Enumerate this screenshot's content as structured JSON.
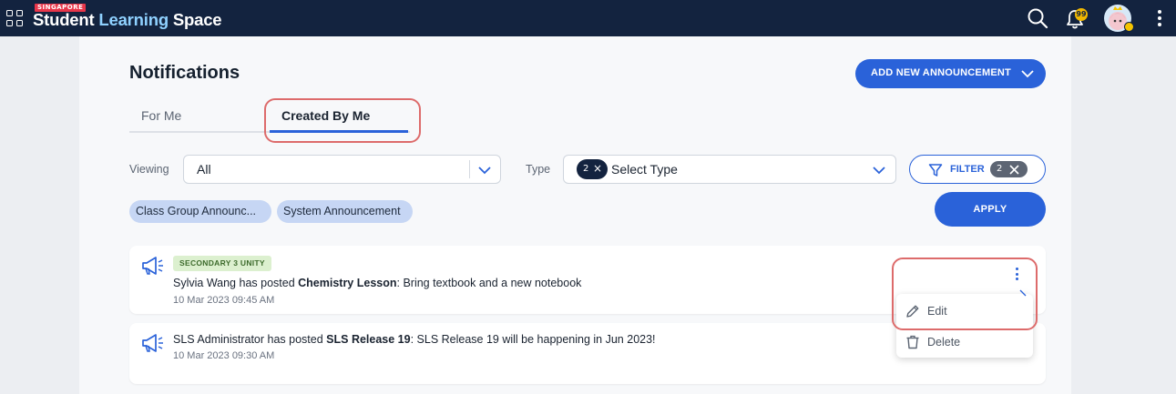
{
  "app": {
    "logo_badge": "SINGAPORE",
    "logo_part1": "Student ",
    "logo_part2": "Learning",
    "logo_part3": " Space",
    "notification_count": "99"
  },
  "page": {
    "title": "Notifications",
    "add_button_label": "ADD NEW ANNOUNCEMENT"
  },
  "tabs": [
    {
      "label": "For Me",
      "active": false
    },
    {
      "label": "Created By Me",
      "active": true
    }
  ],
  "filters": {
    "viewing_label": "Viewing",
    "viewing_value": "All",
    "type_label": "Type",
    "type_selected_count": "2",
    "type_placeholder": "Select Type",
    "filter_button_label": "FILTER",
    "filter_count": "2",
    "tags": [
      "Class Group Announc...",
      "System Announcement"
    ],
    "apply_label": "APPLY"
  },
  "notifications": [
    {
      "badge": "SECONDARY 3 UNITY",
      "author": "Sylvia Wang",
      "verb": " has posted ",
      "title": "Chemistry Lesson",
      "body": ": Bring textbook and a new notebook",
      "time": "10 Mar 2023 09:45 AM"
    },
    {
      "badge": "",
      "author": "SLS Administrator",
      "verb": " has posted ",
      "title": "SLS Release 19",
      "body": ": SLS Release 19 will be happening in Jun 2023!",
      "time": "10 Mar 2023 09:30 AM"
    }
  ],
  "menu": {
    "edit_label": "Edit",
    "delete_label": "Delete"
  },
  "colors": {
    "topbar": "#13233f",
    "accent": "#2a62d9",
    "highlight": "#dd6b6b"
  }
}
